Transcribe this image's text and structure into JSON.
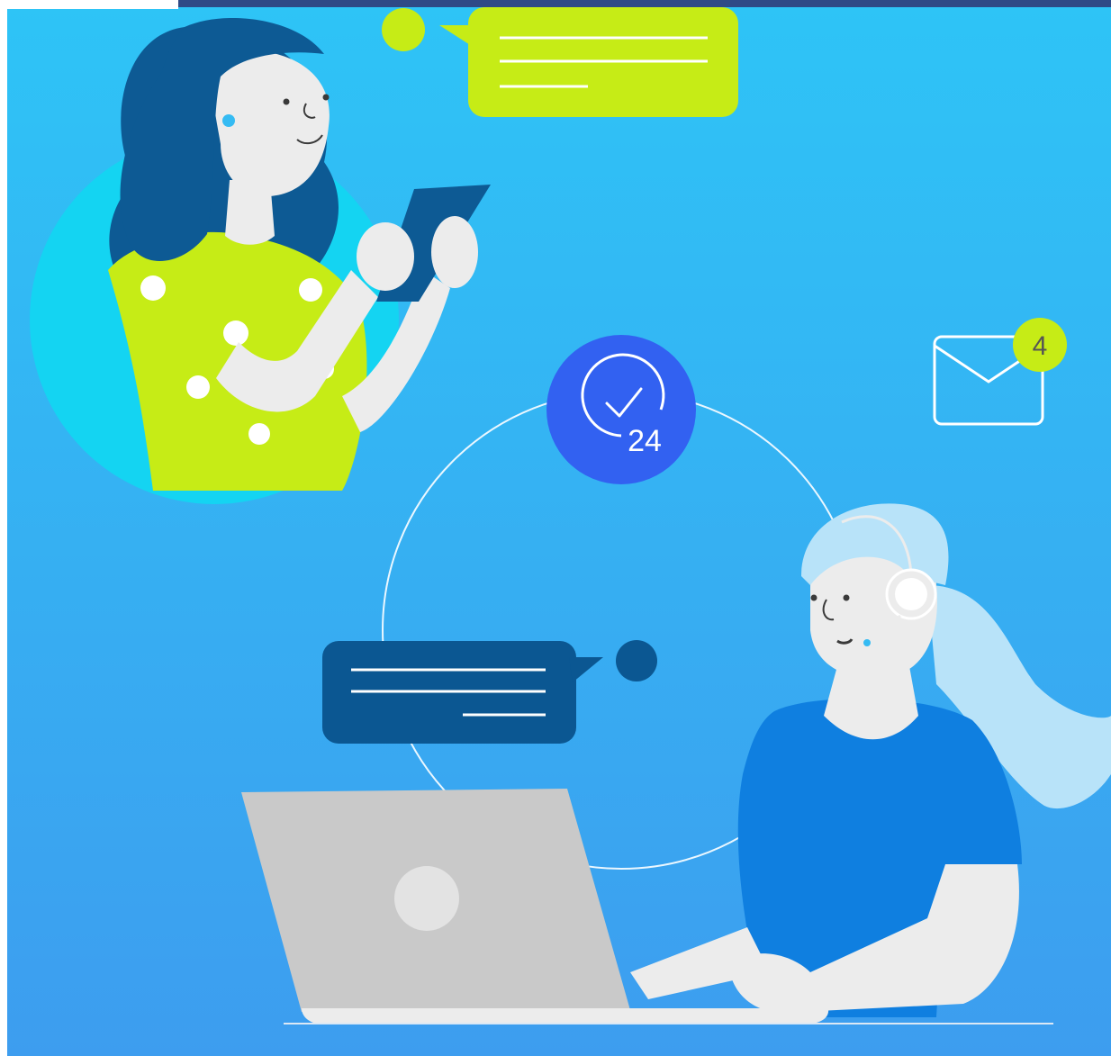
{
  "scene": {
    "badge_count": "4",
    "clock_hours": "24"
  },
  "colors": {
    "background_top": "#2ec4f6",
    "background_bottom": "#3d9def",
    "top_bar": "#2f4a86",
    "lime": "#c6ec16",
    "navy": "#0b5792",
    "clock_circle": "#3261f1",
    "agent_shirt": "#0f7fe0",
    "agent_hair": "#b8e3f9",
    "laptop": "#c9c9c9",
    "skin": "#ececec"
  },
  "icons": {
    "clock": "clock-24h-icon",
    "mail": "envelope-icon",
    "headset": "headset-icon",
    "phone": "smartphone-icon",
    "laptop": "laptop-icon"
  }
}
